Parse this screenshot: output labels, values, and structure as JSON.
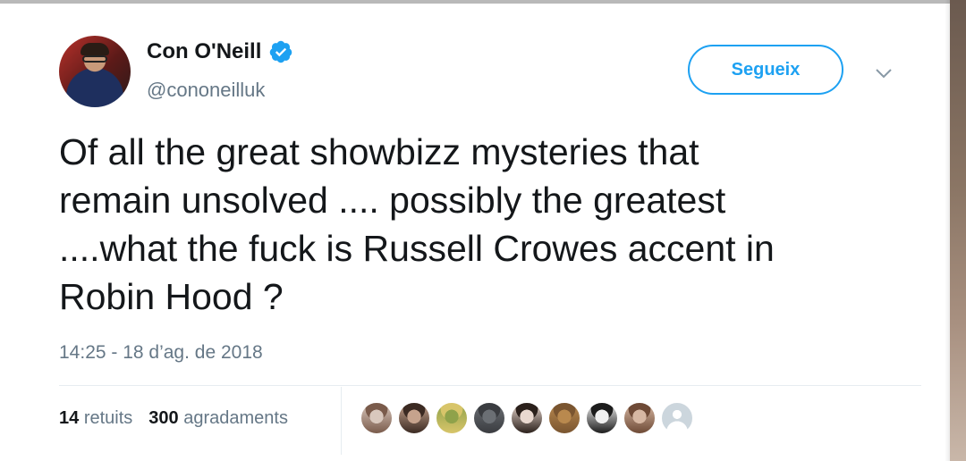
{
  "tweet": {
    "display_name": "Con O'Neill",
    "handle": "@cononeilluk",
    "verified": true,
    "follow_label": "Segueix",
    "text": "Of all the great showbizz mysteries that\nremain unsolved .... possibly the greatest\n....what the fuck is Russell Crowes accent in\nRobin Hood ?",
    "timestamp": "14:25 - 18 d’ag. de 2018",
    "retweets_count": "14",
    "retweets_label": "retuits",
    "likes_count": "300",
    "likes_label": "agradaments"
  },
  "icons": {
    "verified": "verified-badge-icon",
    "caret": "chevron-down-icon"
  },
  "likers": [
    {
      "name": "liker-avatar-1",
      "colors": [
        "#d9c8bd",
        "#7a5b4b"
      ]
    },
    {
      "name": "liker-avatar-2",
      "colors": [
        "#c6a38d",
        "#3b2a22"
      ]
    },
    {
      "name": "liker-avatar-3",
      "colors": [
        "#8fa24a",
        "#d8c56a"
      ]
    },
    {
      "name": "liker-avatar-4",
      "colors": [
        "#6b6f74",
        "#3a3c40"
      ]
    },
    {
      "name": "liker-avatar-5",
      "colors": [
        "#e9d8cf",
        "#2b201b"
      ]
    },
    {
      "name": "liker-avatar-6",
      "colors": [
        "#b9894e",
        "#7a5530"
      ]
    },
    {
      "name": "liker-avatar-7",
      "colors": [
        "#f0f0f0",
        "#1c1c1c"
      ]
    },
    {
      "name": "liker-avatar-8",
      "colors": [
        "#d7b8a3",
        "#6e4a36"
      ]
    },
    {
      "name": "liker-avatar-9",
      "colors": [
        "#ccd6dd",
        "#8899a6"
      ]
    }
  ],
  "colors": {
    "accent": "#1da1f2",
    "text_primary": "#14171a",
    "text_secondary": "#657786",
    "divider": "#e6ecf0"
  }
}
